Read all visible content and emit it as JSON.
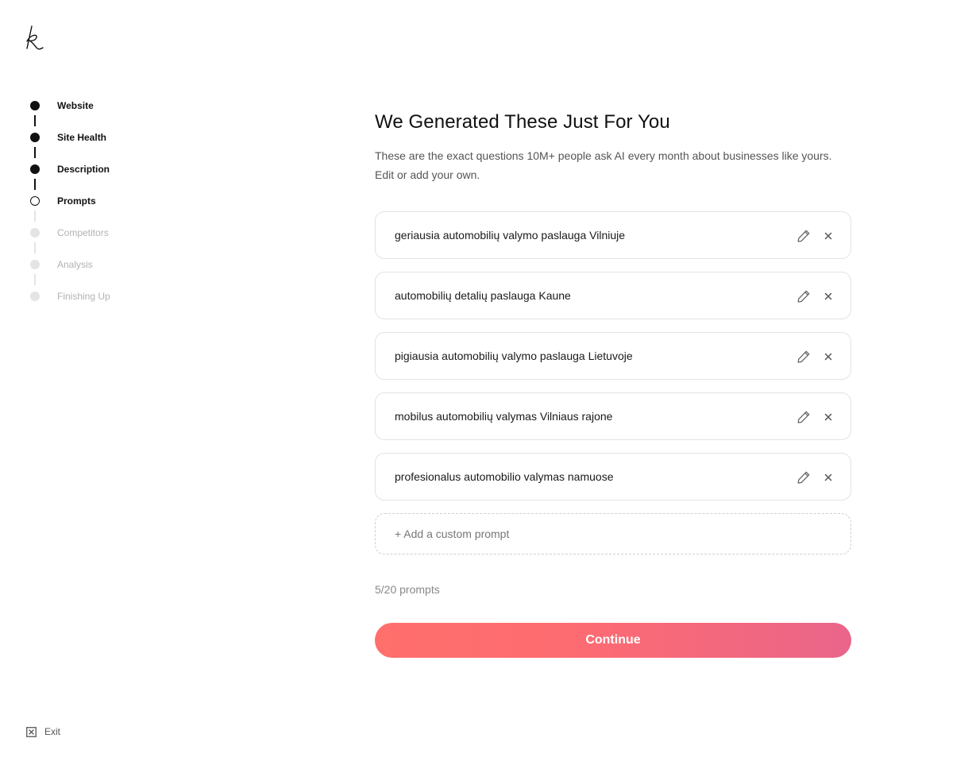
{
  "sidebar": {
    "steps": [
      {
        "label": "Website",
        "state": "done"
      },
      {
        "label": "Site Health",
        "state": "done"
      },
      {
        "label": "Description",
        "state": "done"
      },
      {
        "label": "Prompts",
        "state": "current"
      },
      {
        "label": "Competitors",
        "state": "pending"
      },
      {
        "label": "Analysis",
        "state": "pending"
      },
      {
        "label": "Finishing Up",
        "state": "pending"
      }
    ],
    "exit_label": "Exit"
  },
  "main": {
    "title": "We Generated These Just For You",
    "subtitle": "These are the exact questions 10M+ people ask AI every month about businesses like yours. Edit or add your own.",
    "prompts": [
      "geriausia automobilių valymo paslauga Vilniuje",
      "automobilių detalių paslauga Kaune",
      "pigiausia automobilių valymo paslauga Lietuvoje",
      "mobilus automobilių valymas Vilniaus rajone",
      "profesionalus automobilio valymas namuose"
    ],
    "add_prompt_label": "+ Add a custom prompt",
    "count_label": "5/20 prompts",
    "continue_label": "Continue"
  },
  "colors": {
    "accent_start": "#ff6f6b",
    "accent_end": "#e9658a",
    "step_done": "#111111",
    "step_pending": "#e4e4e4"
  },
  "icons": {
    "logo": "k-script-logo",
    "edit": "pencil-icon",
    "delete": "close-icon",
    "exit": "exit-box-icon"
  }
}
